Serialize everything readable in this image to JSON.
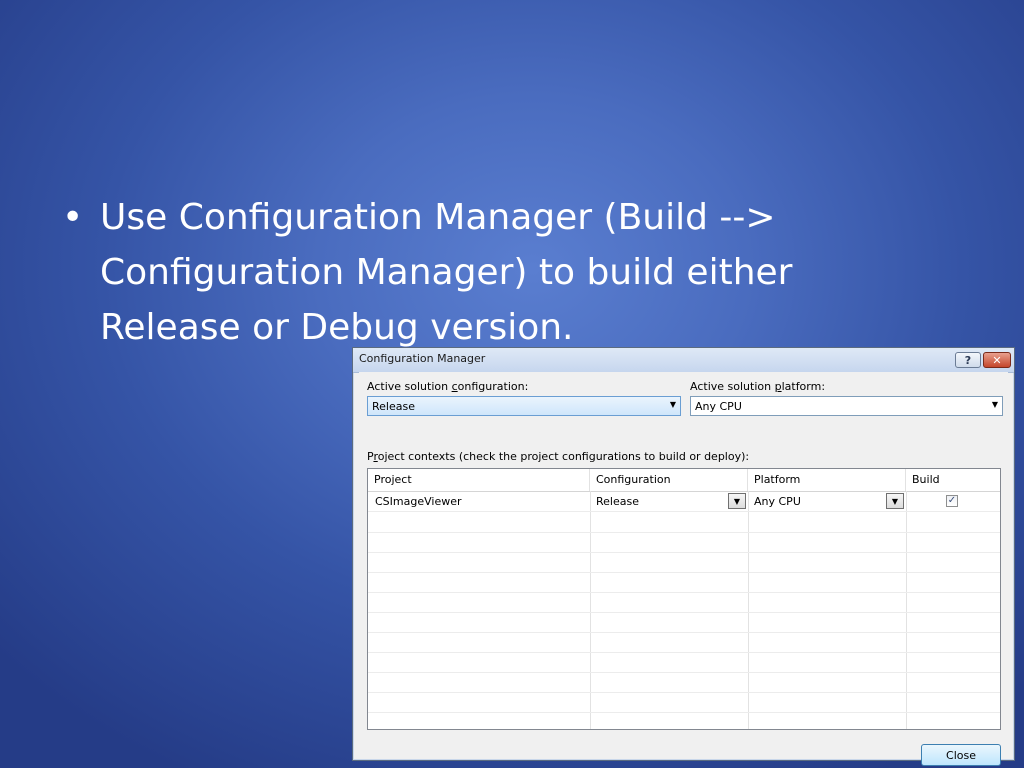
{
  "slide": {
    "bullet": "•",
    "text_line1": "Use Configuration Manager (Build -->",
    "text_line2": "Configuration Manager) to build either",
    "text_line3": "Release or Debug version."
  },
  "dialog": {
    "title": "Configuration Manager",
    "help_label": "?",
    "close_x": "✕",
    "config_label": {
      "pre": "Active solution ",
      "u": "c",
      "post": "onfiguration:"
    },
    "config_value": "Release",
    "platform_label": {
      "pre": "Active solution ",
      "u": "p",
      "post": "latform:"
    },
    "platform_value": "Any CPU",
    "contexts_label": {
      "pre": "P",
      "u": "r",
      "post": "oject contexts (check the project configurations to build or deploy):"
    },
    "columns": [
      "Project",
      "Configuration",
      "Platform",
      "Build"
    ],
    "rows": [
      {
        "project": "CSImageViewer",
        "configuration": "Release",
        "platform": "Any CPU",
        "build": true
      }
    ],
    "check_mark": "✓",
    "dropdown_arrow": "▼",
    "close_button": "Close"
  }
}
